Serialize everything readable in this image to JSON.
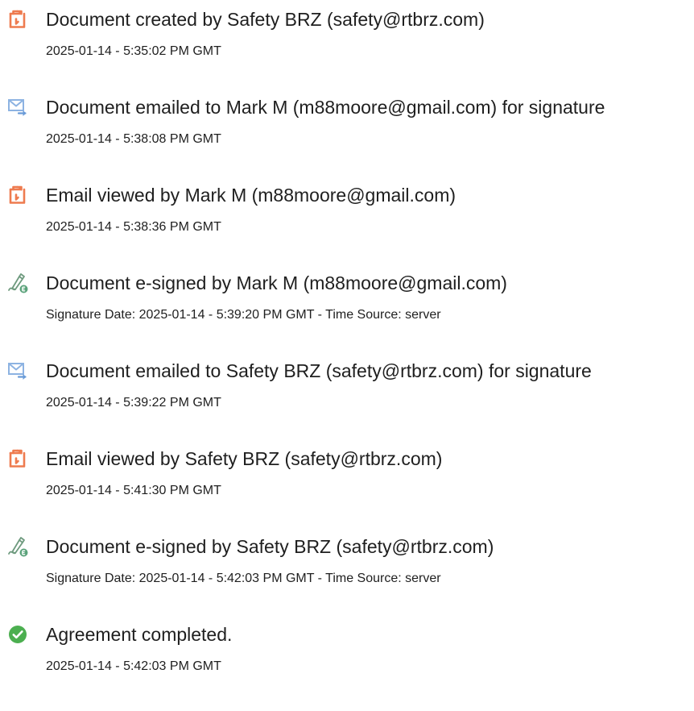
{
  "colors": {
    "document_icon": "#ee7b4f",
    "email_icon": "#8db3e2",
    "sign_icon": "#5aa27a",
    "check_icon": "#4caf50",
    "text": "#1f1f1f"
  },
  "events": [
    {
      "icon": "document-icon",
      "title": "Document created by Safety BRZ (safety@rtbrz.com)",
      "time": "2025-01-14 - 5:35:02 PM GMT"
    },
    {
      "icon": "email-icon",
      "title": "Document emailed to Mark M (m88moore@gmail.com) for signature",
      "time": "2025-01-14 - 5:38:08 PM GMT"
    },
    {
      "icon": "document-icon",
      "title": "Email viewed by Mark M (m88moore@gmail.com)",
      "time": "2025-01-14 - 5:38:36 PM GMT"
    },
    {
      "icon": "esign-icon",
      "title": "Document e-signed by Mark M (m88moore@gmail.com)",
      "time": "Signature Date: 2025-01-14 - 5:39:20 PM GMT - Time Source: server"
    },
    {
      "icon": "email-icon",
      "title": "Document emailed to Safety BRZ (safety@rtbrz.com) for signature",
      "time": "2025-01-14 - 5:39:22 PM GMT"
    },
    {
      "icon": "document-icon",
      "title": "Email viewed by Safety BRZ (safety@rtbrz.com)",
      "time": "2025-01-14 - 5:41:30 PM GMT"
    },
    {
      "icon": "esign-icon",
      "title": "Document e-signed by Safety BRZ (safety@rtbrz.com)",
      "time": "Signature Date: 2025-01-14 - 5:42:03 PM GMT - Time Source: server"
    },
    {
      "icon": "checkmark-icon",
      "title": "Agreement completed.",
      "time": "2025-01-14 - 5:42:03 PM GMT"
    }
  ]
}
